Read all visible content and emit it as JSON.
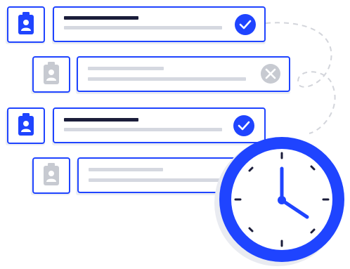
{
  "colors": {
    "accent": "#1f44ff",
    "dark_line": "#1b1d3a",
    "muted_line": "#d5d8e0",
    "muted_icon": "#c7cad1",
    "shadow": "#eceef3",
    "dashed": "#d3d5db",
    "clock_face": "#ffffff",
    "clock_shadow": "#e9ebf1"
  },
  "rows": [
    {
      "state": "complete",
      "icon": "clipboard-user-icon",
      "status_icon": "check-icon"
    },
    {
      "state": "rejected",
      "icon": "clipboard-user-icon",
      "status_icon": "close-icon"
    },
    {
      "state": "complete",
      "icon": "clipboard-user-icon",
      "status_icon": "check-icon"
    },
    {
      "state": "pending",
      "icon": "clipboard-user-icon",
      "status_icon": "none"
    }
  ],
  "clock": {
    "icon": "clock-icon",
    "time_shown": "4:00"
  }
}
